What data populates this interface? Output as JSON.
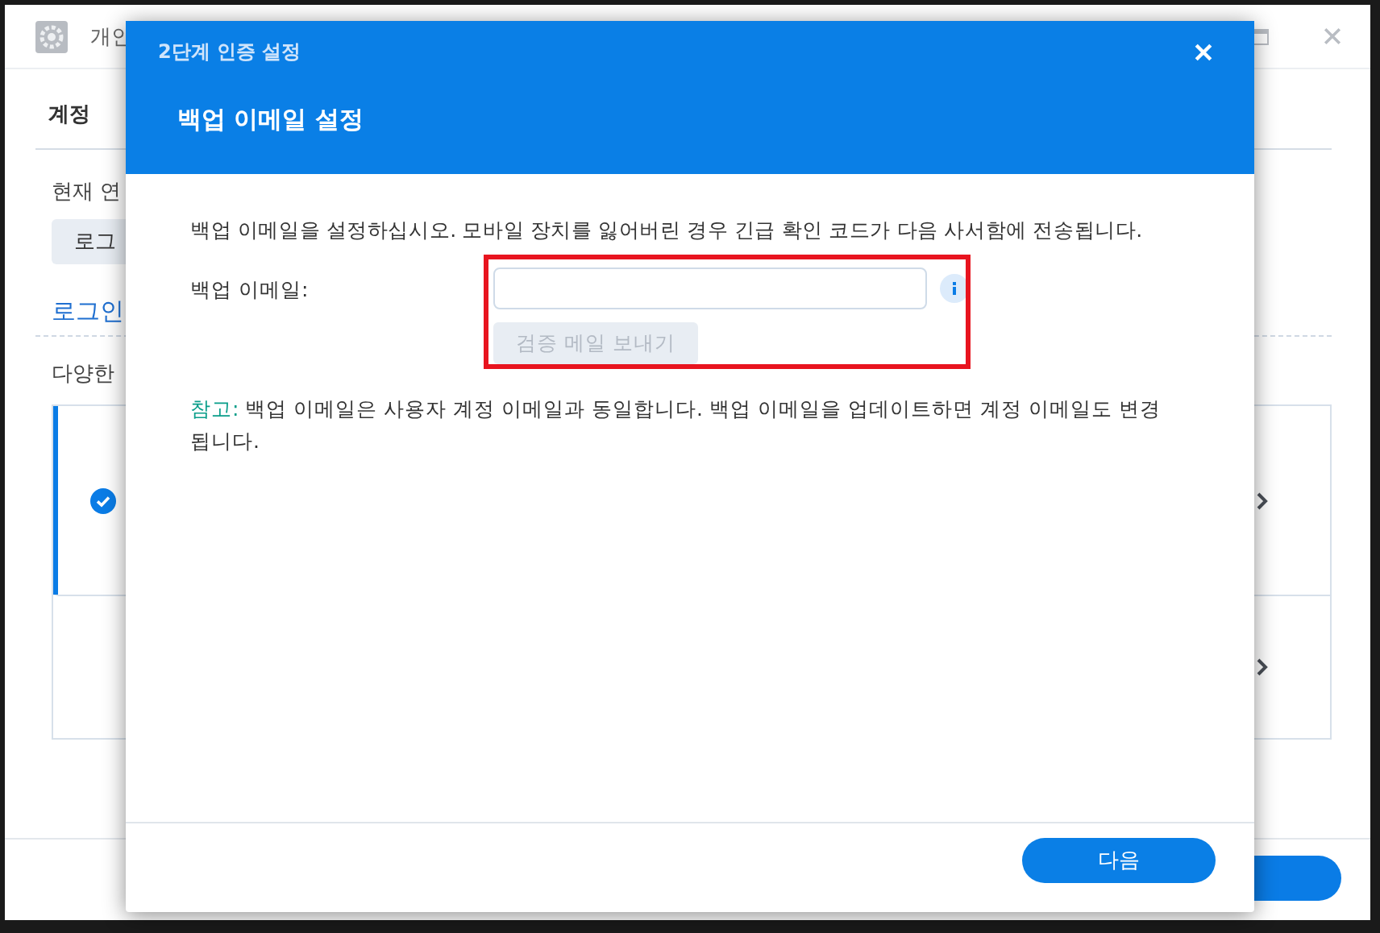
{
  "background_window": {
    "title": "개인",
    "tab": "계정",
    "current_label": "현재 연",
    "login_button": "로그",
    "section_link": "로그인",
    "description": "다양한",
    "methods": [
      {
        "selected": true
      },
      {
        "selected": false
      }
    ]
  },
  "dialog": {
    "title": "2단계 인증 설정",
    "heading": "백업 이메일 설정",
    "intro": "백업 이메일을 설정하십시오. 모바일 장치를 잃어버린 경우 긴급 확인 코드가 다음 사서함에 전송됩니다.",
    "field_label": "백업 이메일:",
    "send_button": {
      "label": "검증 메일 보내기",
      "disabled": true
    },
    "note": {
      "label": "참고:",
      "text": "백업 이메일은 사용자 계정 이메일과 동일합니다. 백업 이메일을 업데이트하면 계정 이메일도 변경됩니다."
    },
    "next_button": "다음"
  }
}
